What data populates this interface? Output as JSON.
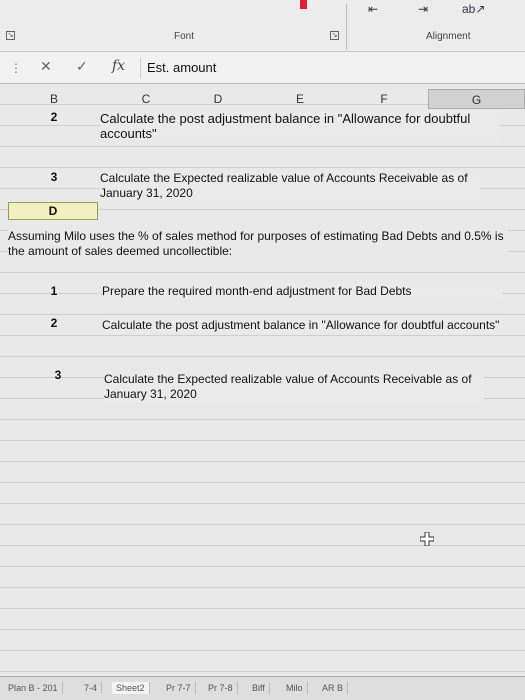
{
  "ribbon": {
    "font_group": "Font",
    "alignment_group": "Alignment"
  },
  "formula_bar": {
    "content": "Est. amount"
  },
  "columns": {
    "B": "B",
    "C": "C",
    "D": "D",
    "E": "E",
    "F": "F",
    "G": "G"
  },
  "part_c": {
    "rows": [
      {
        "num": "2",
        "text": "Calculate the post adjustment balance in \"Allowance for doubtful accounts\""
      },
      {
        "num": "3",
        "text": "Calculate the Expected realizable value of Accounts Receivable as of January 31, 2020"
      }
    ]
  },
  "part_d": {
    "label": "D",
    "intro": "Assuming Milo uses the % of sales method for purposes of estimating Bad Debts and 0.5% is the amount of sales deemed uncollectible:",
    "rows": [
      {
        "num": "1",
        "text": "Prepare the required month-end adjustment for Bad Debts"
      },
      {
        "num": "2",
        "text": "Calculate the post adjustment balance in \"Allowance for doubtful accounts\""
      },
      {
        "num": "3",
        "text": "Calculate the Expected realizable value of Accounts Receivable as of January 31, 2020"
      }
    ]
  },
  "tabs": [
    "Plan B - 201",
    "7-4",
    "Sheet2",
    "Pr 7-7",
    "Pr 7-8",
    "Biff",
    "Milo",
    "AR B"
  ]
}
